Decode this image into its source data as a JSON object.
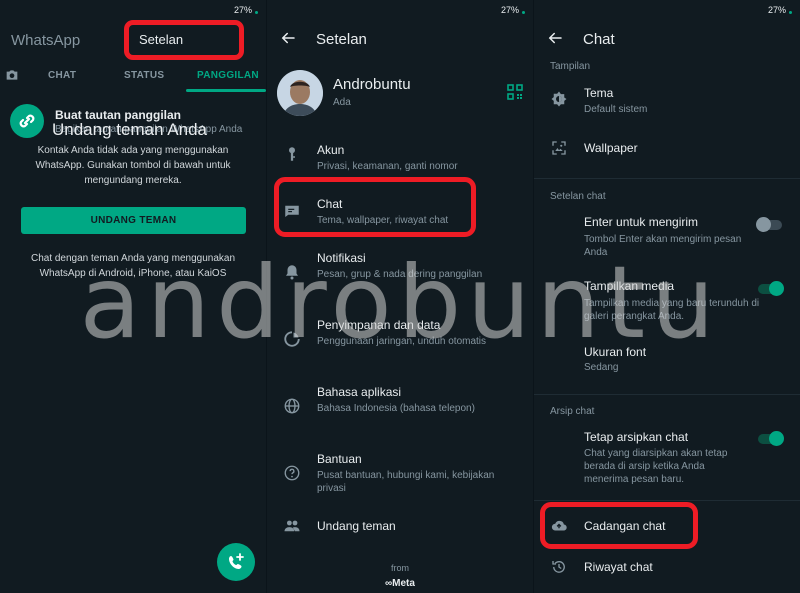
{
  "statusbar": {
    "battery": "27%"
  },
  "panel1": {
    "app_title": "WhatsApp",
    "highlight_label": "Setelan",
    "tabs": [
      {
        "label": "CHAT"
      },
      {
        "label": "STATUS"
      },
      {
        "label": "PANGGILAN"
      }
    ],
    "link": {
      "title": "Buat tautan panggilan",
      "subtitle": "Bagikan tautan panggilan WhatsApp Anda"
    },
    "overlay_heading": "Undang teman Anda",
    "invite_text": "Kontak Anda tidak ada yang menggunakan WhatsApp. Gunakan tombol di bawah untuk mengundang mereka.",
    "invite_button": "UNDANG TEMAN",
    "friends_text": "Chat dengan teman Anda yang menggunakan WhatsApp di Android, iPhone, atau KaiOS"
  },
  "panel2": {
    "title": "Setelan",
    "profile": {
      "name": "Androbuntu",
      "status": "Ada"
    },
    "items": [
      {
        "title": "Akun",
        "subtitle": "Privasi, keamanan, ganti nomor",
        "icon": "key-icon"
      },
      {
        "title": "Chat",
        "subtitle": "Tema, wallpaper, riwayat chat",
        "icon": "chat-icon"
      },
      {
        "title": "Notifikasi",
        "subtitle": "Pesan, grup & nada dering panggilan",
        "icon": "bell-icon"
      },
      {
        "title": "Penyimpanan dan data",
        "subtitle": "Penggunaan jaringan, unduh otomatis",
        "icon": "storage-icon"
      },
      {
        "title": "Bahasa aplikasi",
        "subtitle": "Bahasa Indonesia (bahasa telepon)",
        "icon": "globe-icon"
      },
      {
        "title": "Bantuan",
        "subtitle": "Pusat bantuan, hubungi kami, kebijakan privasi",
        "icon": "help-icon"
      },
      {
        "title": "Undang teman",
        "subtitle": "",
        "icon": "people-icon"
      }
    ],
    "from": "from",
    "meta": "∞Meta"
  },
  "panel3": {
    "title": "Chat",
    "sections": {
      "display": "Tampilan",
      "chat_settings": "Setelan chat",
      "archive": "Arsip chat"
    },
    "theme": {
      "title": "Tema",
      "subtitle": "Default sistem"
    },
    "wallpaper": {
      "title": "Wallpaper"
    },
    "enter_send": {
      "title": "Enter untuk mengirim",
      "subtitle": "Tombol Enter akan mengirim pesan Anda",
      "on": false
    },
    "media_visibility": {
      "title": "Tampilkan media",
      "subtitle": "Tampilkan media yang baru terunduh di galeri perangkat Anda.",
      "on": true
    },
    "font_size": {
      "title": "Ukuran font",
      "subtitle": "Sedang"
    },
    "keep_archived": {
      "title": "Tetap arsipkan chat",
      "subtitle": "Chat yang diarsipkan akan tetap berada di arsip ketika Anda menerima pesan baru.",
      "on": true
    },
    "backup": {
      "title": "Cadangan chat"
    },
    "history": {
      "title": "Riwayat chat"
    }
  },
  "watermark": "androbuntu",
  "colors": {
    "accent": "#00a884",
    "background": "#111b21",
    "highlight": "#ee1c25"
  }
}
